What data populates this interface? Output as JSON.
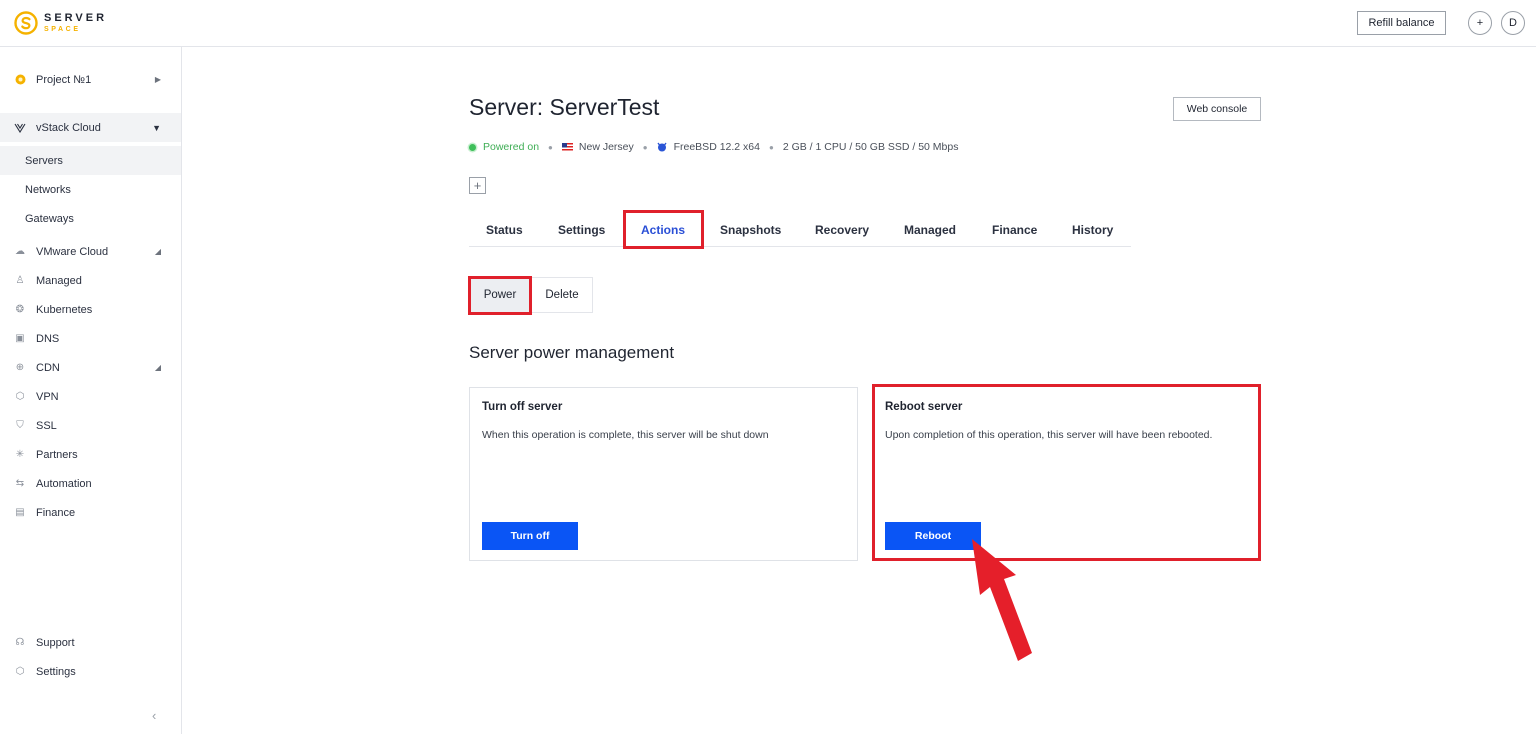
{
  "header": {
    "logo_line1": "SERVER",
    "logo_line2": "SPACE",
    "refill_label": "Refill balance",
    "add_label": "+",
    "avatar_label": "D"
  },
  "sidebar": {
    "project": "Project №1",
    "cloud_group": "vStack Cloud",
    "sub_items": [
      "Servers",
      "Networks",
      "Gateways"
    ],
    "items": [
      "VMware Cloud",
      "Managed",
      "Kubernetes",
      "DNS",
      "CDN",
      "VPN",
      "SSL",
      "Partners",
      "Automation",
      "Finance"
    ],
    "bottom_items": [
      "Support",
      "Settings"
    ]
  },
  "server": {
    "title": "Server: ServerTest",
    "status": "Powered on",
    "location": "New Jersey",
    "os": "FreeBSD 12.2 x64",
    "specs": "2 GB / 1 CPU / 50 GB SSD / 50 Mbps",
    "web_console": "Web console",
    "add_tag": "+"
  },
  "tabs": [
    "Status",
    "Settings",
    "Actions",
    "Snapshots",
    "Recovery",
    "Managed",
    "Finance",
    "History"
  ],
  "active_tab": "Actions",
  "subtabs": {
    "power": "Power",
    "delete": "Delete"
  },
  "section_title": "Server power management",
  "cards": {
    "off": {
      "title": "Turn off server",
      "desc": "When this operation is complete, this server will be shut down",
      "button": "Turn off"
    },
    "reboot": {
      "title": "Reboot server",
      "desc": "Upon completion of this operation, this server will have been rebooted.",
      "button": "Reboot"
    }
  },
  "colors": {
    "primary": "#0a55f5",
    "highlight": "#e0202b",
    "status_green": "#3fae55",
    "brand_yellow": "#f5b200"
  }
}
